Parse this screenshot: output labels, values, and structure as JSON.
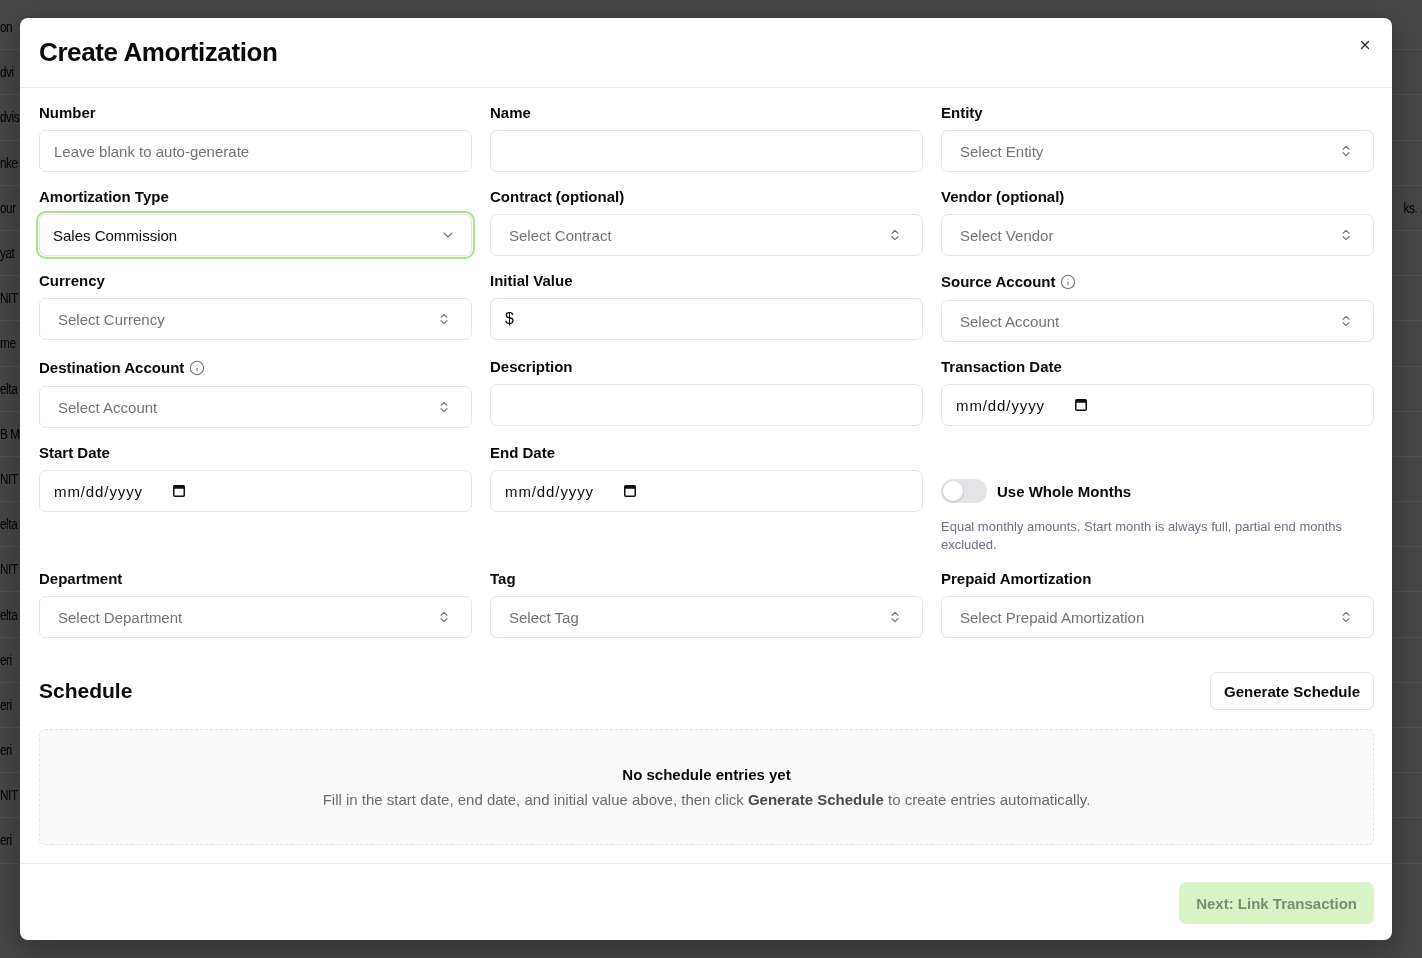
{
  "background_table": {
    "rows": [
      {
        "text": "on"
      },
      {
        "text": "dvi"
      },
      {
        "text": "dvis"
      },
      {
        "text": "nke"
      },
      {
        "text": "our",
        "text_right": "ks."
      },
      {
        "text": "yat"
      },
      {
        "text": "NIT"
      },
      {
        "text": "me"
      },
      {
        "text": "elta"
      },
      {
        "text": "B M"
      },
      {
        "text": "NIT"
      },
      {
        "text": "elta"
      },
      {
        "text": "NIT"
      },
      {
        "text": "elta"
      },
      {
        "text": "eri"
      },
      {
        "text": "eri"
      },
      {
        "text": "eri"
      },
      {
        "text": "NIT"
      },
      {
        "text": "eri"
      }
    ]
  },
  "dialog": {
    "title": "Create Amortization",
    "fields": [
      {
        "kind": "text",
        "label": "Number",
        "placeholder": "Leave blank to auto-generate",
        "focused": false
      },
      {
        "kind": "text",
        "label": "Name",
        "focused": false
      },
      {
        "kind": "combobox",
        "label": "Entity",
        "placeholder": "Select Entity",
        "focused": false
      },
      {
        "kind": "select",
        "label": "Amortization Type",
        "value": "Sales Commission",
        "focused": true
      },
      {
        "kind": "combobox",
        "label": "Contract (optional)",
        "placeholder": "Select Contract",
        "focused": false
      },
      {
        "kind": "combobox",
        "label": "Vendor (optional)",
        "placeholder": "Select Vendor",
        "focused": false
      },
      {
        "kind": "combobox",
        "label": "Currency",
        "placeholder": "Select Currency",
        "focused": false
      },
      {
        "kind": "money",
        "label": "Initial Value",
        "prefix": "$",
        "focused": false
      },
      {
        "kind": "combobox",
        "label": "Source Account",
        "info_icon": true,
        "placeholder": "Select Account",
        "focused": false
      },
      {
        "kind": "combobox",
        "label": "Destination Account",
        "info_icon": true,
        "placeholder": "Select Account",
        "focused": false
      },
      {
        "kind": "text",
        "label": "Description",
        "focused": false
      },
      {
        "kind": "date",
        "label": "Transaction Date",
        "placeholder": "mm/dd/yyyy",
        "focused": false
      },
      {
        "kind": "date",
        "label": "Start Date",
        "placeholder": "mm/dd/yyyy",
        "focused": false
      },
      {
        "kind": "date",
        "label": "End Date",
        "placeholder": "mm/dd/yyyy",
        "focused": false
      },
      {
        "kind": "toggle",
        "label": "Use Whole Months",
        "on": false,
        "hint": "Equal monthly amounts. Start month is always full, partial end months excluded."
      },
      {
        "kind": "combobox",
        "label": "Department",
        "placeholder": "Select Department",
        "focused": false
      },
      {
        "kind": "combobox",
        "label": "Tag",
        "placeholder": "Select Tag",
        "focused": false
      },
      {
        "kind": "combobox",
        "label": "Prepaid Amortization",
        "placeholder": "Select Prepaid Amortization",
        "focused": false
      }
    ],
    "schedule": {
      "title": "Schedule",
      "generate_button": "Generate Schedule",
      "empty_title": "No schedule entries yet",
      "empty_text": "Fill in the start date, end date, and initial value above, then click **Generate Schedule** to create entries automatically."
    },
    "footer": {
      "next_button": {
        "label": "Next: Link Transaction",
        "disabled": true
      }
    }
  }
}
